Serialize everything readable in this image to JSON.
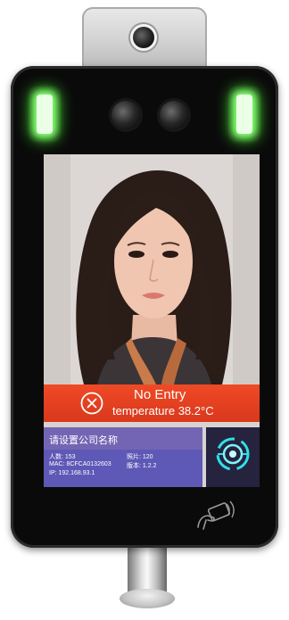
{
  "device": {
    "status_color": "#e2411f",
    "accent_color": "#2fe0e8",
    "led_color": "#8dff7a"
  },
  "screen": {
    "alert": {
      "icon": "close-circle-icon",
      "title": "No Entry",
      "temperature": "temperature 38.2°C"
    },
    "company": {
      "name": "请设置公司名称"
    },
    "info": {
      "people_count": "人数: 153",
      "photos": "照片: 120",
      "mac": "MAC: 8CFCA0132603",
      "version": "版本: 1.2.2",
      "ip": "IP: 192.168.93.1"
    },
    "side_icon": "face-scan-icon"
  },
  "reader": {
    "icon": "nfc-card-tap-icon"
  }
}
